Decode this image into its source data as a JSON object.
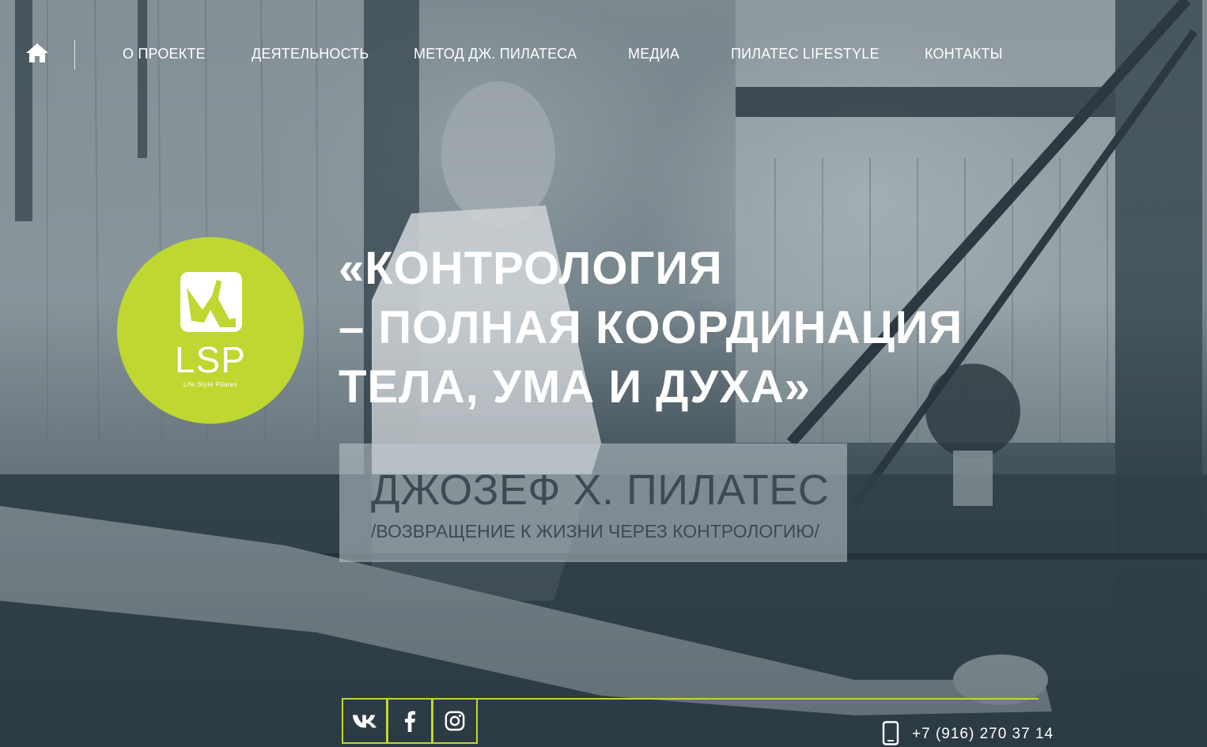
{
  "nav": {
    "home_icon": "home-icon",
    "items": [
      {
        "label": "О ПРОЕКТЕ"
      },
      {
        "label": "ДЕЯТЕЛЬНОСТЬ"
      },
      {
        "label": "МЕТОД ДЖ. ПИЛАТЕСА"
      },
      {
        "label": "МЕДИА"
      },
      {
        "label": "ПИЛАТЕС LIFESTYLE"
      },
      {
        "label": "КОНТАКТЫ"
      }
    ]
  },
  "logo": {
    "text": "LSP",
    "subtitle": "Life Style Pilates",
    "color": "#bfd730"
  },
  "hero": {
    "quote_lines": [
      "«КОНТРОЛОГИЯ",
      "– ПОЛНАЯ КООРДИНАЦИЯ",
      "ТЕЛА, УМА И ДУХА»"
    ],
    "author": "ДЖОЗЕФ Х. ПИЛАТЕС",
    "book": "/ВОЗВРАЩЕНИЕ К ЖИЗНИ ЧЕРЕЗ КОНТРОЛОГИЮ/"
  },
  "footer": {
    "social": [
      {
        "icon": "vk-icon"
      },
      {
        "icon": "facebook-icon"
      },
      {
        "icon": "instagram-icon"
      }
    ],
    "phone_icon": "mobile-phone-icon",
    "phone": "+7 (916) 270 37 14",
    "accent": "#bfd730"
  }
}
